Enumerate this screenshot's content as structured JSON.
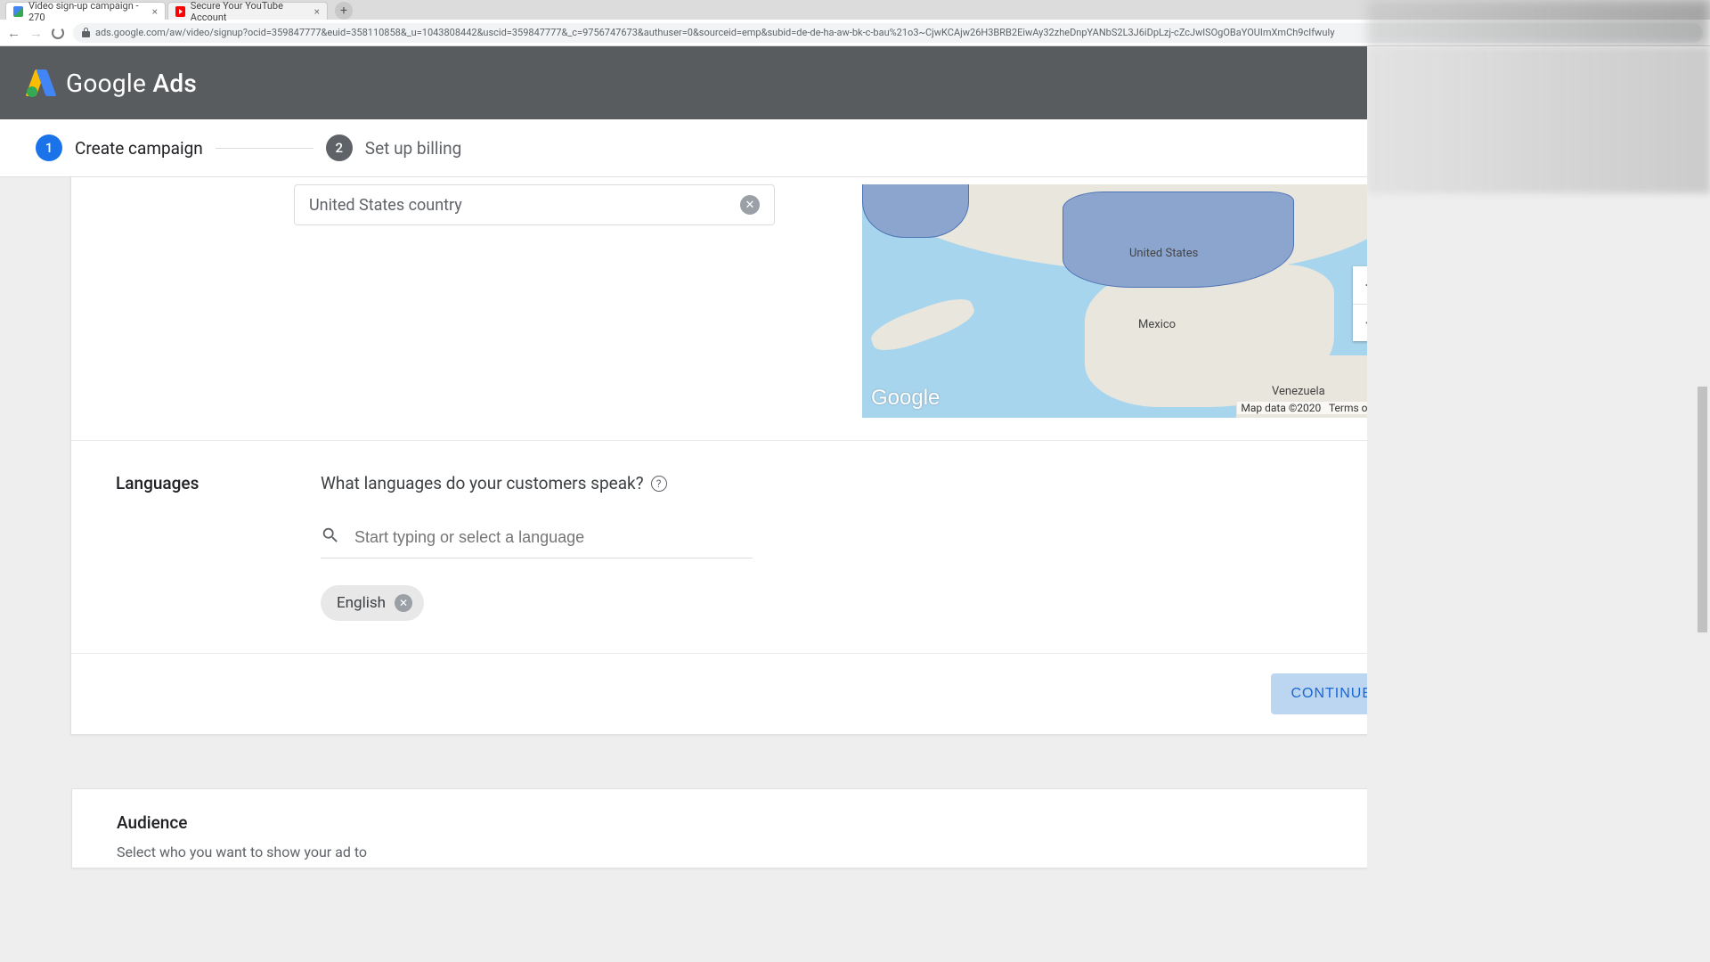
{
  "browser": {
    "tabs": [
      {
        "title": "Video sign-up campaign - 270",
        "active": true
      },
      {
        "title": "Secure Your YouTube Account",
        "active": false
      }
    ],
    "url": "ads.google.com/aw/video/signup?ocid=359847777&euid=358110858&_u=1043808442&uscid=359847777&_c=9756747673&authuser=0&sourceid=emp&subid=de-de-ha-aw-bk-c-bau%21o3~CjwKCAjw26H3BRB2EiwAy32zheDnpYANbS2L3J6iDpLzj-cZcJwlSOgOBaYOUImXmCh9cIfwuIy"
  },
  "header": {
    "logo_text_1": "Google",
    "logo_text_2": " Ads"
  },
  "stepper": {
    "step1_num": "1",
    "step1_label": "Create campaign",
    "step2_num": "2",
    "step2_label": "Set up billing"
  },
  "location": {
    "chip": "United States country"
  },
  "map": {
    "label_us": "United States",
    "label_mx": "Mexico",
    "label_vz": "Venezuela",
    "logo": "Google",
    "attrib": "Map data ©2020",
    "terms": "Terms of Use"
  },
  "languages": {
    "section": "Languages",
    "question": "What languages do your customers speak?",
    "placeholder": "Start typing or select a language",
    "chip": "English"
  },
  "actions": {
    "continue": "CONTINUE"
  },
  "audience": {
    "title": "Audience",
    "subtitle": "Select who you want to show your ad to"
  }
}
